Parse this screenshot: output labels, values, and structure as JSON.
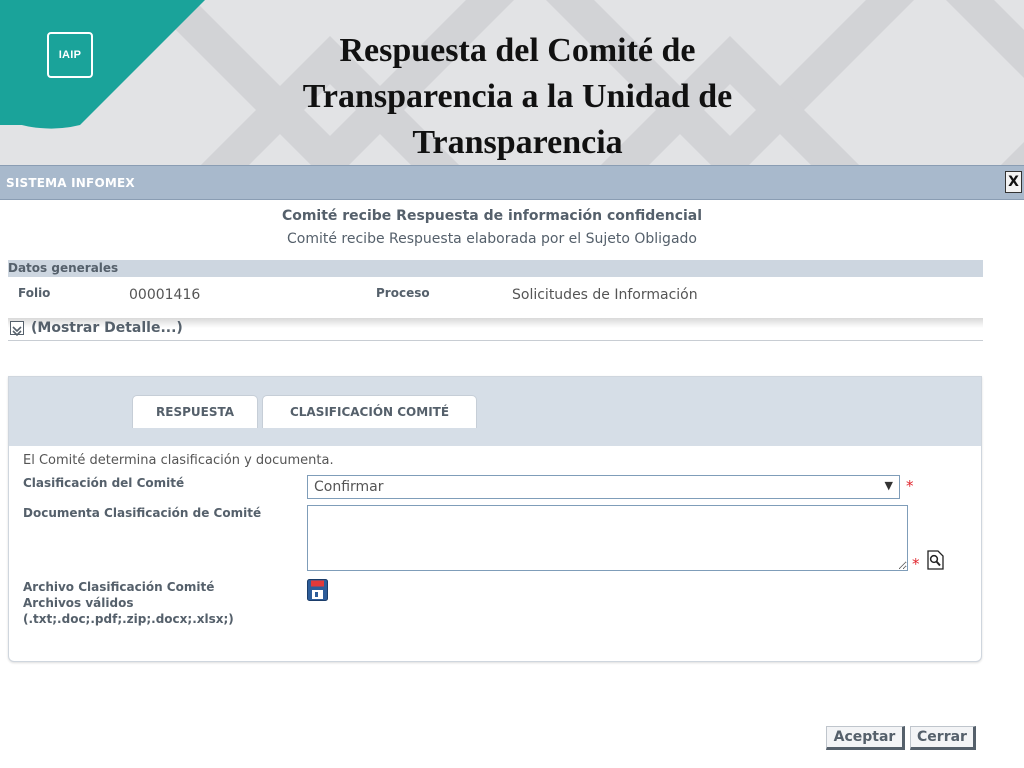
{
  "slide": {
    "logo_text": "IAIP",
    "title": "Respuesta del Comité de Transparencia a la Unidad de Transparencia",
    "colors": {
      "teal": "#1aa39a",
      "header_bg": "#e2e3e5"
    }
  },
  "window": {
    "title": "SISTEMA INFOMEX",
    "close_label": "X",
    "header_line1": "Comité recibe Respuesta de información confidencial",
    "header_line2": "Comité recibe Respuesta elaborada por el Sujeto Obligado"
  },
  "datos_generales": {
    "section_title": "Datos generales",
    "folio_label": "Folio",
    "folio_value": "00001416",
    "proceso_label": "Proceso",
    "proceso_value": "Solicitudes de Información",
    "toggle_icon": "chevron-double-down-icon",
    "toggle_label": "(Mostrar Detalle...)"
  },
  "tabs": [
    {
      "label": "RESPUESTA"
    },
    {
      "label": "CLASIFICACIÓN COMITÉ"
    }
  ],
  "form": {
    "intro": "El Comité determina clasificación y documenta.",
    "clasificacion_label": "Clasificación del Comité",
    "clasificacion_value": "Confirmar",
    "documenta_label": "Documenta Clasificación de Comité",
    "documenta_value": "",
    "required_mark": "*",
    "archivo_label": "Archivo Clasificación Comité",
    "archivos_validos_label": "Archivos válidos",
    "archivos_validos_ext": "(.txt;.doc;.pdf;.zip;.docx;.xlsx;)",
    "spell_icon": "search-document-icon",
    "upload_icon": "floppy-disk-icon"
  },
  "buttons": {
    "accept": "Aceptar",
    "close": "Cerrar"
  }
}
